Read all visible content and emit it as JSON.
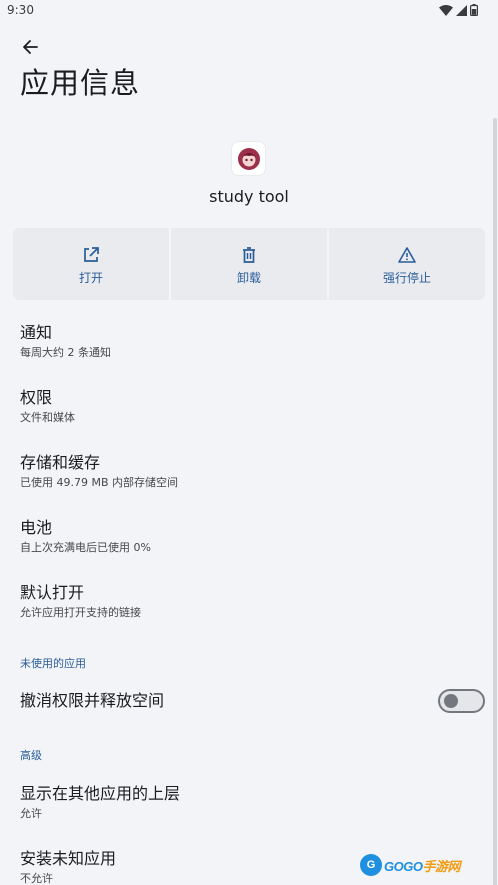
{
  "status_bar": {
    "time": "9:30",
    "icons": [
      "wifi-icon",
      "cell-signal-icon",
      "battery-icon"
    ]
  },
  "header": {
    "back_icon": "arrow-left-icon",
    "title": "应用信息"
  },
  "app": {
    "name": "study tool",
    "icon": "app-avatar-icon"
  },
  "actions": [
    {
      "label": "打开",
      "icon": "open-external-icon"
    },
    {
      "label": "卸载",
      "icon": "trash-icon"
    },
    {
      "label": "强行停止",
      "icon": "warning-triangle-icon"
    }
  ],
  "items": {
    "notifications": {
      "title": "通知",
      "subtitle": "每周大约 2 条通知"
    },
    "permissions": {
      "title": "权限",
      "subtitle": "文件和媒体"
    },
    "storage": {
      "title": "存储和缓存",
      "subtitle": "已使用 49.79 MB 内部存储空间"
    },
    "battery": {
      "title": "电池",
      "subtitle": "自上次充满电后已使用 0%"
    },
    "open_by_default": {
      "title": "默认打开",
      "subtitle": "允许应用打开支持的链接"
    }
  },
  "unused_apps": {
    "header": "未使用的应用",
    "revoke_label": "撤消权限并释放空间",
    "revoke_enabled": false
  },
  "advanced": {
    "header": "高级",
    "display_over": {
      "title": "显示在其他应用的上层",
      "subtitle": "允许"
    },
    "install_unknown": {
      "title": "安装未知应用",
      "subtitle": "不允许"
    }
  },
  "watermark": {
    "logo_letter": "G",
    "text_main": "GOGO",
    "text_accent": "手游网"
  },
  "colors": {
    "background": "#f2f4f7",
    "accent": "#2b5d9a",
    "action_bg": "#e9ebef",
    "toggle_off": "#74777d"
  }
}
